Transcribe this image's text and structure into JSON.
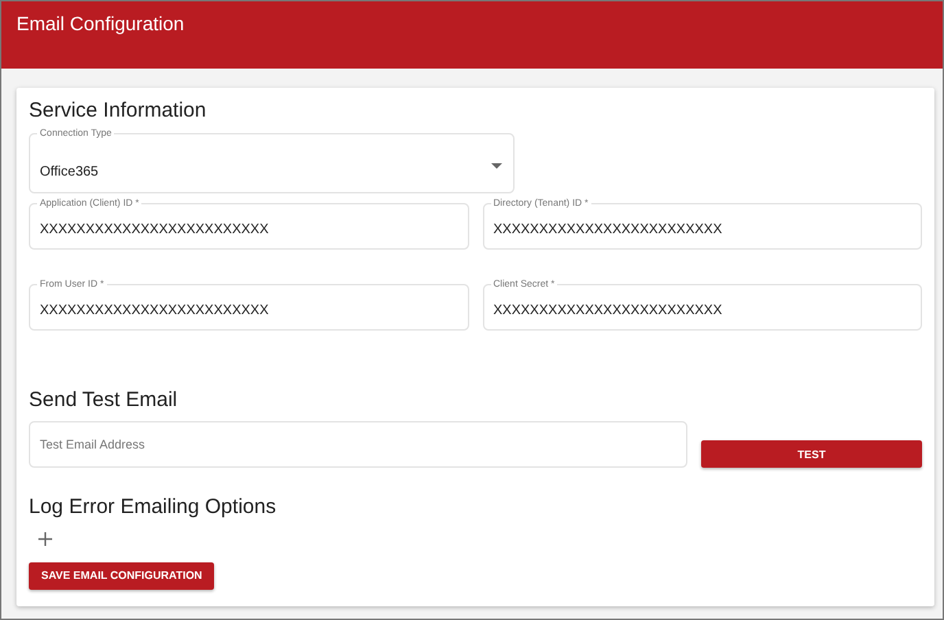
{
  "header": {
    "title": "Email Configuration"
  },
  "service_information": {
    "heading": "Service Information",
    "connection_type": {
      "label": "Connection Type",
      "value": "Office365"
    },
    "fields": [
      {
        "label": "Application (Client) ID *",
        "value": "XXXXXXXXXXXXXXXXXXXXXXXXX"
      },
      {
        "label": "Directory (Tenant) ID *",
        "value": "XXXXXXXXXXXXXXXXXXXXXXXXX"
      },
      {
        "label": "From User ID *",
        "value": "XXXXXXXXXXXXXXXXXXXXXXXXX"
      },
      {
        "label": "Client Secret *",
        "value": "XXXXXXXXXXXXXXXXXXXXXXXXX"
      }
    ]
  },
  "send_test_email": {
    "heading": "Send Test Email",
    "placeholder": "Test Email Address",
    "button": "TEST"
  },
  "log_error_emailing_options": {
    "heading": "Log Error Emailing Options"
  },
  "save_button": "SAVE EMAIL CONFIGURATION"
}
